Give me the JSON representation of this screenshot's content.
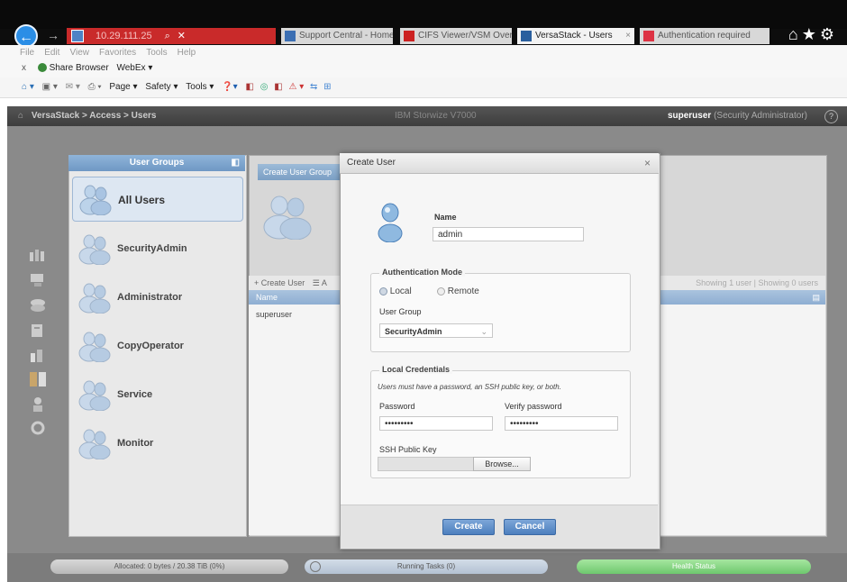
{
  "browser": {
    "address": "10.29.111.25",
    "tabs": [
      {
        "label": "Support Central - Home",
        "active": false
      },
      {
        "label": "CIFS Viewer/VSM Over...",
        "active": false
      },
      {
        "label": "VersaStack - Users",
        "active": true
      },
      {
        "label": "Authentication required",
        "active": false
      }
    ],
    "menu": [
      "File",
      "Edit",
      "View",
      "Favorites",
      "Tools",
      "Help"
    ],
    "favorites": {
      "close": "x",
      "share_browser": "Share Browser",
      "webex": "WebEx ▾"
    },
    "command_bar": {
      "page": "Page ▾",
      "safety": "Safety ▾",
      "tools": "Tools ▾"
    }
  },
  "app_header": {
    "breadcrumb": "VersaStack > Access > Users",
    "product": "IBM Storwize V7000",
    "user": "superuser",
    "role": "(Security Administrator)",
    "help": "?"
  },
  "user_groups": {
    "title": "User Groups",
    "items": [
      {
        "label": "All Users",
        "selected": true
      },
      {
        "label": "SecurityAdmin",
        "selected": false
      },
      {
        "label": "Administrator",
        "selected": false
      },
      {
        "label": "CopyOperator",
        "selected": false
      },
      {
        "label": "Service",
        "selected": false
      },
      {
        "label": "Monitor",
        "selected": false
      }
    ]
  },
  "content": {
    "create_group_button": "Create User Group",
    "create_user_link": "+ Create User",
    "actions_link": "☰ A",
    "showing": "Showing 1 user | Showing 0 users",
    "column_name": "Name",
    "rows": [
      "superuser"
    ]
  },
  "dialog": {
    "title": "Create User",
    "close": "×",
    "name_label": "Name",
    "name_value": "admin",
    "auth_mode": {
      "legend": "Authentication Mode",
      "local": "Local",
      "remote": "Remote",
      "selected": "Local",
      "group_label": "User Group",
      "group_value": "SecurityAdmin"
    },
    "credentials": {
      "legend": "Local Credentials",
      "note": "Users must have a password, an SSH public key, or both.",
      "password_label": "Password",
      "password_value": "•••••••••",
      "verify_label": "Verify password",
      "verify_value": "•••••••••",
      "ssh_label": "SSH Public Key",
      "browse": "Browse..."
    },
    "create_button": "Create",
    "cancel_button": "Cancel"
  },
  "status": {
    "allocated": "Allocated: 0 bytes / 20.38 TiB (0%)",
    "running_tasks": "Running Tasks (0)",
    "health": "Health Status"
  },
  "colors": {
    "accent_blue": "#4d7fbe",
    "address_red": "#c92a2a",
    "health_green": "#6ec86e"
  }
}
